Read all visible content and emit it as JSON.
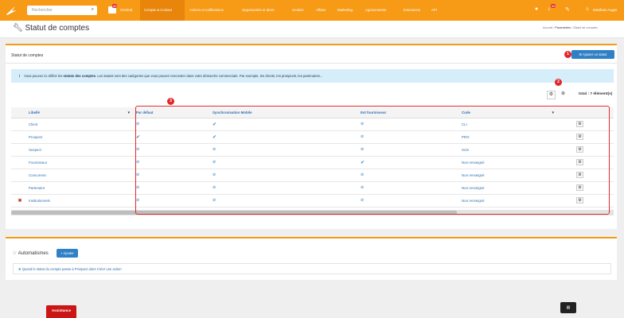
{
  "topbar": {
    "search_placeholder": "Rechercher",
    "search_icon": "search-icon",
    "notif_count": "88",
    "menu": [
      "Général",
      "Compte & Contact",
      "Actions et notifications",
      "Opportunités et devis",
      "Gestion",
      "Affaire",
      "Marketing",
      "Agencements",
      "Extensions",
      "API"
    ],
    "alert_count": "88",
    "user": "Matthias Auger",
    "brand_color": "#f79a15"
  },
  "page": {
    "title": "Statut de comptes",
    "breadcrumb": [
      "Accueil",
      "Paramètres",
      "Statut de comptes"
    ]
  },
  "card": {
    "title": "Statut de comptes",
    "add_button": "Ajouter un statut",
    "info_lead": "Vous pouvez ici définir les ",
    "info_bold": "statuts des comptes",
    "info_rest": ". Les statuts sont des catégories que vous pouvez rencontrer dans votre démarche commerciale. Par exemple, les clients, les prospects, les partenaires...",
    "total": "total : 7 élément(s)",
    "annotations": [
      "1",
      "2",
      "3"
    ]
  },
  "table": {
    "headers": [
      "",
      "Libellé",
      "Par défaut",
      "Synchronisation Mobile",
      "Est fournisseur",
      "Code",
      ""
    ],
    "rows": [
      {
        "x": "",
        "label": "Client",
        "default": "ban",
        "sync": "check",
        "supplier": "ban",
        "code": "CLI"
      },
      {
        "x": "",
        "label": "Prospect",
        "default": "check",
        "sync": "check",
        "supplier": "ban",
        "code": "PRO"
      },
      {
        "x": "",
        "label": "Suspect",
        "default": "ban",
        "sync": "ban",
        "supplier": "ban",
        "code": "SUS"
      },
      {
        "x": "",
        "label": "Fournisseur",
        "default": "ban",
        "sync": "ban",
        "supplier": "check",
        "code": "Non renseigné"
      },
      {
        "x": "",
        "label": "Concurrent",
        "default": "ban",
        "sync": "ban",
        "supplier": "ban",
        "code": "Non renseigné"
      },
      {
        "x": "",
        "label": "Partenaire",
        "default": "ban",
        "sync": "ban",
        "supplier": "ban",
        "code": "Non renseigné"
      },
      {
        "x": "✖",
        "label": "Institutionnels",
        "default": "ban",
        "sync": "ban",
        "supplier": "ban",
        "code": "Non renseigné"
      }
    ]
  },
  "automatismes": {
    "title": "Automatismes",
    "add_button": "Ajouter",
    "rule": "Quand le statut du compte passe à Prospect alors Créer une action"
  },
  "footer": {
    "assist": "Assistance"
  }
}
